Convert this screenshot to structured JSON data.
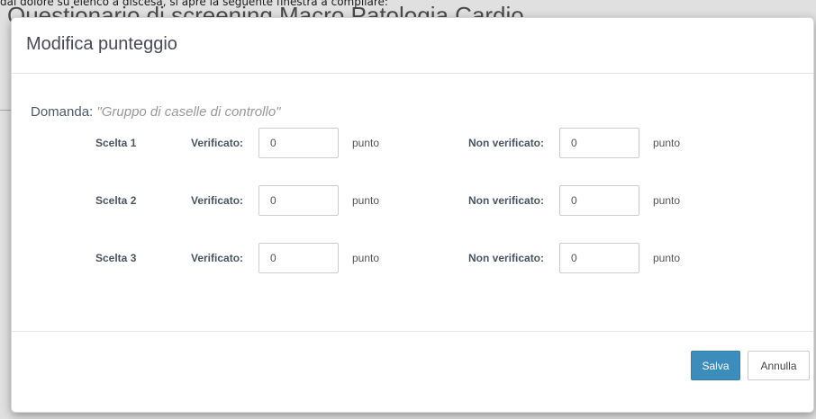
{
  "background": {
    "caption": "dal dolore su elenco a discesa, si apre la seguente finestra a compilare:",
    "heading": "Questionario di screening Macro Patologia Cardio"
  },
  "modal": {
    "title": "Modifica punteggio",
    "question_label": "Domanda:",
    "question_text": "\"Gruppo di caselle di controllo\"",
    "verified_label": "Verificato:",
    "not_verified_label": "Non verificato:",
    "unit": "punto",
    "choices": [
      {
        "label": "Scelta 1",
        "verified_value": "0",
        "not_verified_value": "0"
      },
      {
        "label": "Scelta 2",
        "verified_value": "0",
        "not_verified_value": "0"
      },
      {
        "label": "Scelta 3",
        "verified_value": "0",
        "not_verified_value": "0"
      }
    ],
    "save_label": "Salva",
    "cancel_label": "Annulla"
  },
  "colors": {
    "primary_button": "#3c8dbc",
    "title_text": "#4a4a5a",
    "question_hint": "#999999"
  }
}
